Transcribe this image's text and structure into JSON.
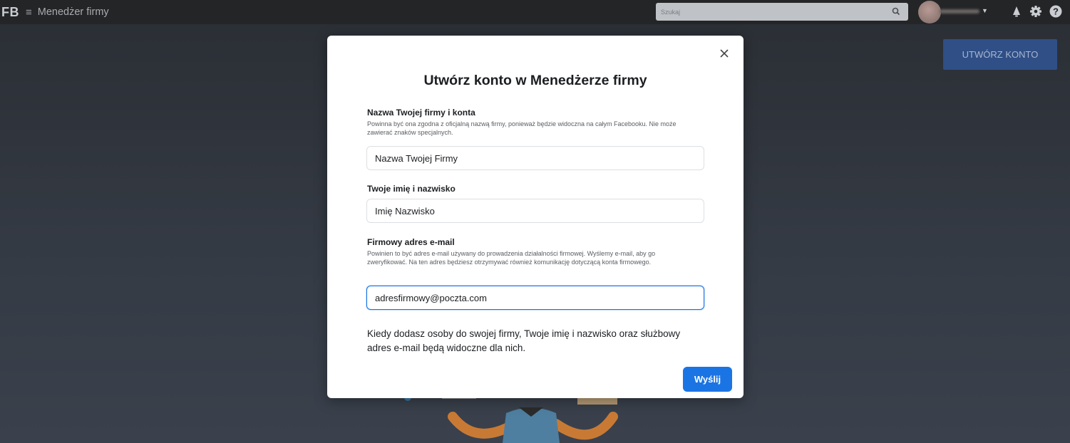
{
  "header": {
    "logo": "FB",
    "menu_icon": "hamburger-icon",
    "app_title": "Menedżer firmy",
    "search_placeholder": "Szukaj",
    "icons": [
      "search-icon",
      "bell-icon",
      "gear-icon",
      "help-icon"
    ]
  },
  "background": {
    "create_account_button": "UTWÓRZ KONTO"
  },
  "modal": {
    "title": "Utwórz konto w Menedżerze firmy",
    "close_icon": "close-icon",
    "fields": [
      {
        "label": "Nazwa Twojej firmy i konta",
        "help": "Powinna być ona zgodna z oficjalną nazwą firmy, ponieważ będzie widoczna na całym Facebooku. Nie może zawierać znaków specjalnych.",
        "value": "Nazwa Twojej Firmy"
      },
      {
        "label": "Twoje imię i nazwisko",
        "help": "",
        "value": "Imię Nazwisko"
      },
      {
        "label": "Firmowy adres e-mail",
        "help": "Powinien to być adres e-mail używany do prowadzenia działalności firmowej. Wyślemy e-mail, aby go zweryfikować. Na ten adres będziesz otrzymywać również komunikację dotyczącą konta firmowego.",
        "value": "adresfirmowy@poczta.com"
      }
    ],
    "info": "Kiedy dodasz osoby do swojej firmy, Twoje imię i nazwisko oraz służbowy adres e-mail będą widoczne dla nich.",
    "submit_label": "Wyślij"
  },
  "colors": {
    "primary": "#1b74e4",
    "topbar": "#242526",
    "background": "#2f343c"
  }
}
